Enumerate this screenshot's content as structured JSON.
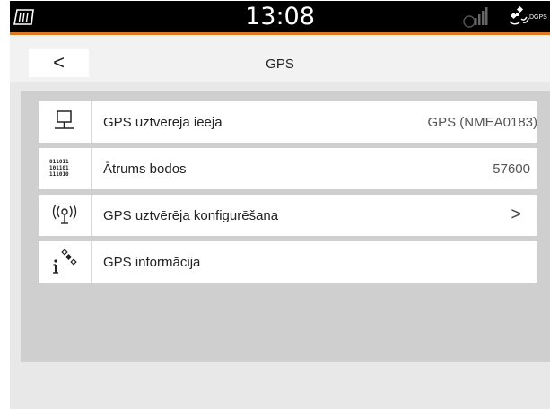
{
  "statusbar": {
    "time": "13:08",
    "icons": [
      "memory-card-icon",
      "signal-strength-icon",
      "satellite-icon"
    ],
    "dgps_label": "DGPS",
    "accent_color": "#e0771f"
  },
  "nav": {
    "back_glyph": "<",
    "title": "GPS"
  },
  "rows": [
    {
      "icon": "gps-receiver-input-icon",
      "label": "GPS uztvērēja ieeja",
      "value": "GPS (NMEA0183)"
    },
    {
      "icon": "baud-rate-icon",
      "icon_text": [
        "011011",
        "101101",
        "111010"
      ],
      "label": "Ātrums bodos",
      "value": "57600"
    },
    {
      "icon": "radio-antenna-icon",
      "label": "GPS uztvērēja konfigurēšana",
      "chevron": ">"
    },
    {
      "icon": "gps-info-icon",
      "label": "GPS informācija"
    }
  ]
}
